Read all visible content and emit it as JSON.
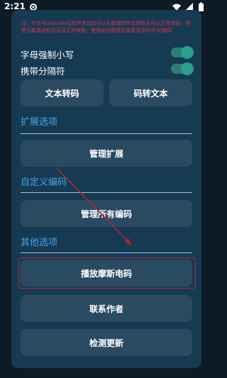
{
  "status_bar": {
    "time": "2:21",
    "icons": [
      "gear-icon",
      "wifi-icon",
      "signal-icon",
      "battery-icon"
    ]
  },
  "warning_text": "注：中文与Unicode互转开关启动可以无前缀转中文转码且可以正常转回，但是可能其他软件无法正常转换，使用此功能建议直接关闭符号\\的编码",
  "toggles": [
    {
      "label": "字母强制小写",
      "on": true
    },
    {
      "label": "携带分隔符",
      "on": true
    }
  ],
  "buttons": {
    "text_encode": "文本转码",
    "code_to_text": "码转文本",
    "manage_extensions": "管理扩展",
    "manage_all_codes": "管理所有编码",
    "play_morse": "播放摩斯电码",
    "contact_author": "联系作者",
    "check_update": "检测更新"
  },
  "sections": {
    "extensions": "扩展选项",
    "custom_encoding": "自定义编码",
    "other_options": "其他选项"
  },
  "colors": {
    "background": "#0d1b26",
    "card": "#173a53",
    "button": "#2a4a62",
    "accent": "#42a5e8",
    "toggle": "#29a18b",
    "warning": "#e0304a",
    "highlight": "#b02a33"
  }
}
